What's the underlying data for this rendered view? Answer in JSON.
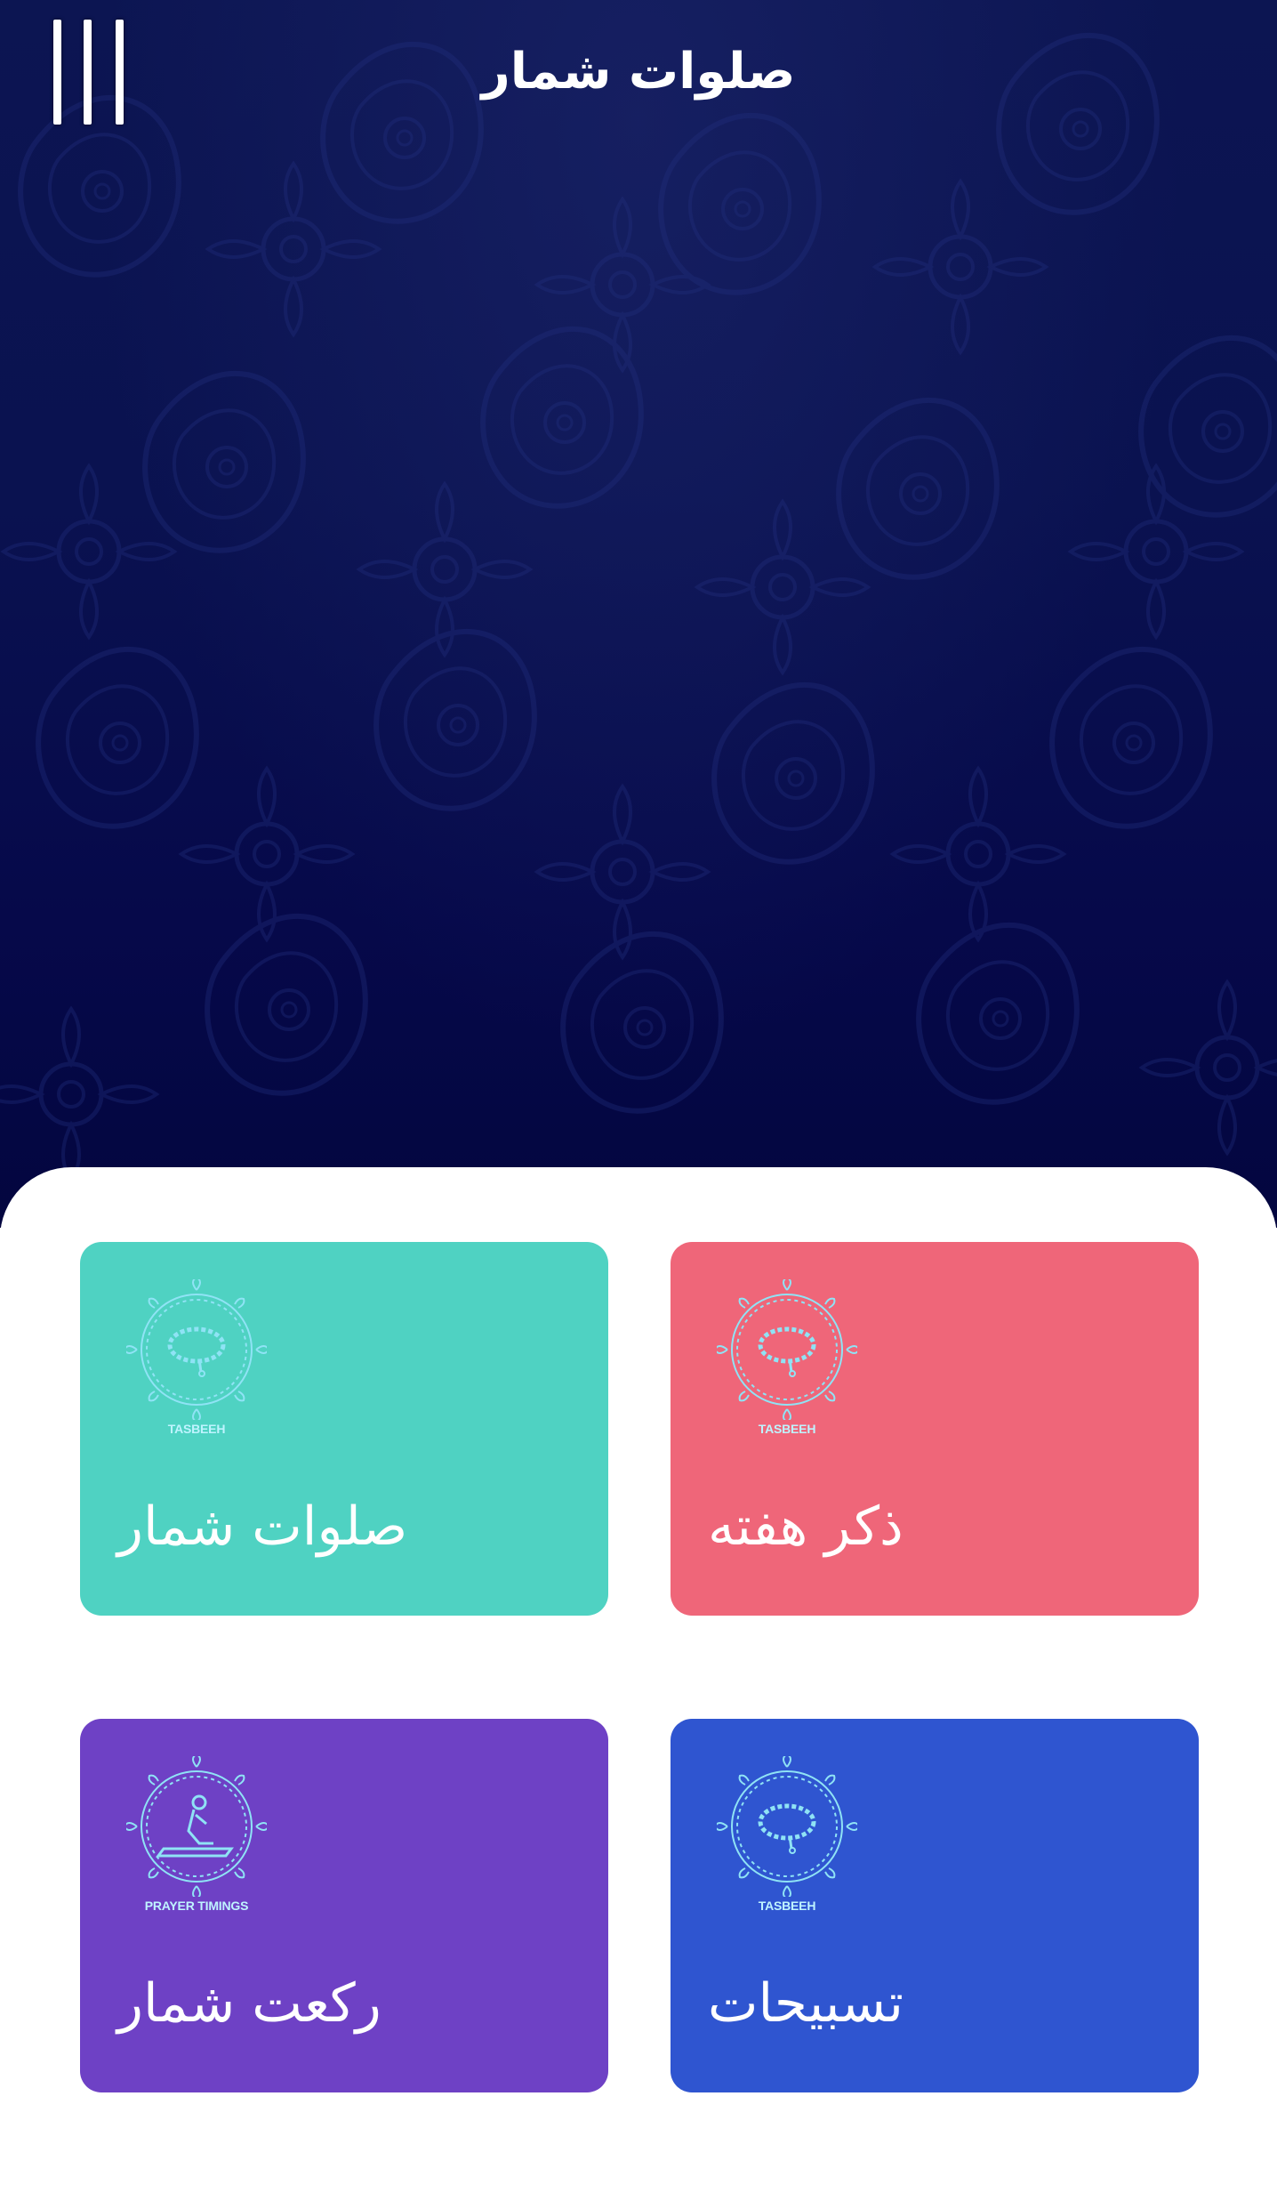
{
  "header": {
    "title": "صلوات شمار"
  },
  "menu": {
    "icon": "hamburger-vertical-icon"
  },
  "cards": [
    {
      "label": "ذکر هفته",
      "icon_caption": "TASBEEH",
      "icon": "tasbeeh-beads-icon",
      "color": "#ef6679"
    },
    {
      "label": "صلوات شمار",
      "icon_caption": "TASBEEH",
      "icon": "tasbeeh-beads-icon",
      "color": "#4fd2c2"
    },
    {
      "label": "تسبیحات",
      "icon_caption": "TASBEEH",
      "icon": "tasbeeh-beads-icon",
      "color": "#2f55d0"
    },
    {
      "label": "رکعت شمار",
      "icon_caption": "PRAYER TIMINGS",
      "icon": "prayer-timings-icon",
      "color": "#6e41c5"
    }
  ],
  "colors": {
    "header_dark": "#0a1250",
    "sheet": "#ffffff",
    "icon_line": "#8fe3f5"
  }
}
